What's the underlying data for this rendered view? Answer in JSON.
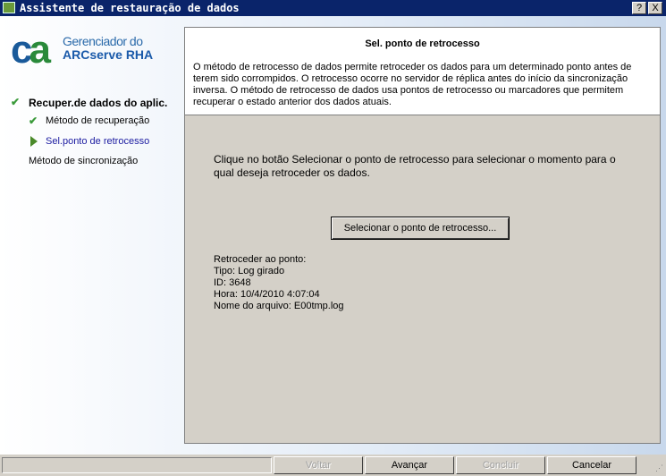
{
  "window": {
    "title": "Assistente de restauração de dados",
    "help": "?",
    "close": "X"
  },
  "logo": {
    "mark": "ca",
    "line1": "Gerenciador do",
    "line2": "ARCserve RHA"
  },
  "steps": [
    {
      "label": "Recuper.de dados do aplic.",
      "state": "done"
    },
    {
      "label": "Método de recuperação",
      "state": "done"
    },
    {
      "label": "Sel.ponto de retrocesso",
      "state": "current"
    },
    {
      "label": "Método de sincronização",
      "state": "pending"
    }
  ],
  "panel": {
    "title": "Sel. ponto de retrocesso",
    "description": "O método de retrocesso de dados permite retroceder os dados para um determinado ponto antes de terem sido corrompidos. O retrocesso ocorre no servidor de réplica antes do início da sincronização inversa. O método de retrocesso de dados usa pontos de retrocesso ou marcadores que permitem recuperar o estado anterior dos dados atuais.",
    "instruction": "Clique no botão Selecionar o ponto de retrocesso para selecionar o momento para o qual deseja retroceder os dados.",
    "select_button": "Selecionar o ponto de retrocesso...",
    "info": [
      "Retroceder ao ponto:",
      "Tipo: Log girado",
      "ID: 3648",
      "Hora: 10/4/2010 4:07:04",
      "Nome do arquivo: E00tmp.log"
    ]
  },
  "buttons": {
    "back": "Voltar",
    "next": "Avançar",
    "finish": "Concluir",
    "cancel": "Cancelar"
  }
}
